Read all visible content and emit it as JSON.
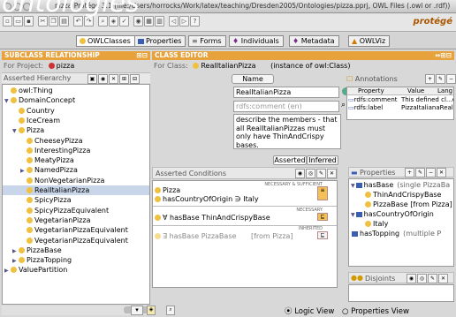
{
  "overlay_title": "ontologies",
  "window": {
    "title": "pizza  Protégé 3.1     (file:/Users/horrocks/Work/latex/teaching/Dresden2005/Ontologies/pizza.pprj, OWL Files (.owl or .rdf))",
    "brand": "protégé"
  },
  "tabs": [
    {
      "label": "OWLClasses",
      "icon": "class-dot"
    },
    {
      "label": "Properties",
      "icon": "property-square"
    },
    {
      "label": "Forms",
      "icon": "forms-icon"
    },
    {
      "label": "Individuals",
      "icon": "individuals-diamond"
    },
    {
      "label": "Metadata",
      "icon": "metadata-diamond"
    },
    {
      "label": "OWLViz",
      "icon": "owlviz-icon"
    }
  ],
  "left": {
    "header": "SUBCLASS RELATIONSHIP",
    "for_project_label": "For Project:",
    "project": "pizza",
    "hierarchy_label": "Asserted Hierarchy",
    "tree": [
      {
        "label": "owl:Thing",
        "depth": 0,
        "expander": ""
      },
      {
        "label": "DomainConcept",
        "depth": 0,
        "expander": "open"
      },
      {
        "label": "Country",
        "depth": 1,
        "expander": ""
      },
      {
        "label": "IceCream",
        "depth": 1,
        "expander": ""
      },
      {
        "label": "Pizza",
        "depth": 1,
        "expander": "open"
      },
      {
        "label": "CheeseyPizza",
        "depth": 2,
        "expander": ""
      },
      {
        "label": "InterestingPizza",
        "depth": 2,
        "expander": ""
      },
      {
        "label": "MeatyPizza",
        "depth": 2,
        "expander": ""
      },
      {
        "label": "NamedPizza",
        "depth": 2,
        "expander": "closed"
      },
      {
        "label": "NonVegetarianPizza",
        "depth": 2,
        "expander": ""
      },
      {
        "label": "RealItalianPizza",
        "depth": 2,
        "expander": "",
        "selected": true
      },
      {
        "label": "SpicyPizza",
        "depth": 2,
        "expander": ""
      },
      {
        "label": "SpicyPizzaEquivalent",
        "depth": 2,
        "expander": ""
      },
      {
        "label": "VegetarianPizza",
        "depth": 2,
        "expander": ""
      },
      {
        "label": "VegetarianPizzaEquivalent",
        "depth": 2,
        "expander": ""
      },
      {
        "label": "VegetarianPizzaEquivalent",
        "depth": 2,
        "expander": ""
      },
      {
        "label": "PizzaBase",
        "depth": 1,
        "expander": "closed"
      },
      {
        "label": "PizzaTopping",
        "depth": 1,
        "expander": "closed"
      },
      {
        "label": "ValuePartition",
        "depth": 0,
        "expander": "closed"
      }
    ]
  },
  "editor": {
    "header": "CLASS EDITOR",
    "for_class_label": "For Class:",
    "class_name": "RealItalianPizza",
    "instance_of": "(instance of owl:Class)",
    "name_label": "Name",
    "name_value": "RealItalianPizza",
    "comment_placeholder": "rdfs:comment (en)",
    "comment_text": "describe the members - that all RealItalianPizzas must only have ThinAndCrispy bases.",
    "annotations_label": "Annotations",
    "annotation_cols": [
      "Property",
      "Value",
      "Lang"
    ],
    "annotation_rows": [
      {
        "property": "rdfs:comment",
        "value": "This defined cl...en",
        "lang": ""
      },
      {
        "property": "rdfs:label",
        "value": "PizzaItalianaRealpt",
        "lang": ""
      }
    ],
    "asserted_tab": "Asserted",
    "inferred_tab": "Inferred",
    "conditions_label": "Asserted Conditions",
    "nec_suf_label": "NECESSARY & SUFFICIENT",
    "necessary_label": "NECESSARY",
    "inherited_label": "INHERITED",
    "conditions": [
      {
        "text": "Pizza",
        "group": "nec-suf"
      },
      {
        "text": "hasCountryOfOrigin ∋ Italy",
        "group": "nec-suf"
      },
      {
        "text": "∀ hasBase ThinAndCrispyBase",
        "group": "necessary"
      },
      {
        "text": "∃ hasBase PizzaBase",
        "from": "[from Pizza]",
        "group": "inherited"
      }
    ],
    "properties_label": "Properties",
    "properties": [
      {
        "name": "hasBase",
        "note": "(single PizzaBa",
        "children": [
          "ThinAndCrispyBase",
          "PizzaBase  [from Pizza]"
        ]
      },
      {
        "name": "hasCountryOfOrigin",
        "note": "",
        "children": [
          "Italy"
        ]
      },
      {
        "name": "hasTopping",
        "note": "(multiple P",
        "children": []
      }
    ],
    "disjoints_label": "Disjoints",
    "view_logic": "Logic View",
    "view_properties": "Properties View"
  },
  "colors": {
    "accent_orange": "#e8a23c",
    "class_yellow": "#f0c040",
    "selected_row": "#c9d6ea",
    "property_blue": "#3a5fb0"
  }
}
